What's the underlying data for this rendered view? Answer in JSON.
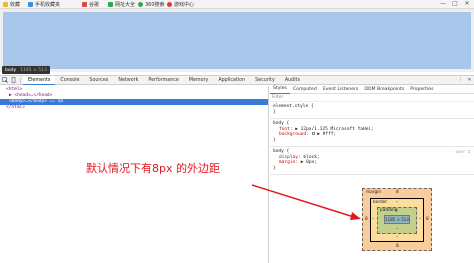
{
  "bookmarks": [
    {
      "label": "收藏",
      "icon": "star-icon",
      "color": "#f5b82e"
    },
    {
      "label": "手机收藏夹",
      "icon": "phone-icon",
      "color": "#3a8ee6"
    },
    {
      "label": "谷歌",
      "icon": "google-icon",
      "color": "#e04a3a"
    },
    {
      "label": "网址大全",
      "icon": "web-directory-icon",
      "color": "#2fa84f"
    },
    {
      "label": "360搜索",
      "icon": "search-icon",
      "color": "#33a853"
    },
    {
      "label": "游戏中心",
      "icon": "game-icon",
      "color": "#e23a3a"
    }
  ],
  "window_controls": {
    "min": "—",
    "max": "□",
    "close": "✕"
  },
  "tooltip": {
    "element": "body",
    "size": "1185 × 513"
  },
  "devtools": {
    "tabs": [
      "Elements",
      "Console",
      "Sources",
      "Network",
      "Performance",
      "Memory",
      "Application",
      "Security",
      "Audits"
    ],
    "active_tab": "Elements",
    "close": "✕"
  },
  "elements_tree": {
    "html_open": "<html>",
    "head": "▶ <head>…</head>",
    "body": "<body>…</body>",
    "body_suffix": "== $0",
    "html_close": "</html>"
  },
  "styles_tabs": [
    "Styles",
    "Computed",
    "Event Listeners",
    "DOM Breakpoints",
    "Properties"
  ],
  "filter_placeholder": "Filter",
  "rules": [
    {
      "selector": "element.style {",
      "props": [],
      "close": "}",
      "source": ""
    },
    {
      "selector": "body {",
      "props": [
        {
          "name": "font:",
          "value": "▶ 12px/1.125 Microsoft YaHei;"
        },
        {
          "name": "background:",
          "value": "▶ #fff;"
        }
      ],
      "close": "}",
      "source": ""
    },
    {
      "selector": "body {",
      "props": [
        {
          "name": "display:",
          "value": "block;"
        },
        {
          "name": "margin:",
          "value": "▶ 8px;"
        }
      ],
      "close": "}",
      "source": "user a"
    }
  ],
  "box_model": {
    "margin_label": "margin",
    "margin_top": "8",
    "margin_left": "8",
    "margin_right": "8",
    "margin_bottom": "8",
    "border_label": "border",
    "border_top": "–",
    "border_left": "–",
    "border_right": "–",
    "border_bottom": "–",
    "padding_label": "padding",
    "padding_top": "–",
    "padding_bottom": "–",
    "content": "1185 × 513",
    "content_bottom": "–"
  },
  "annotation": "默认情况下有8px 的外边距",
  "colors": {
    "annotation": "#e0191f",
    "highlight": "#a7c6ea",
    "selection": "#3879d9",
    "margin": "#f9cc9d",
    "border": "#fddd9b",
    "padding": "#c3d08b",
    "content": "#8cb6c0"
  }
}
